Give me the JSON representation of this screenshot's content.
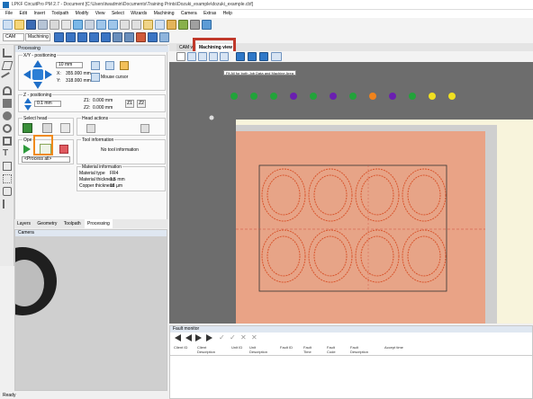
{
  "window": {
    "title": "LPKF CircuitPro PM 2.7 - Document [C:\\Users\\twadmin\\Documents\\Training Prints\\Dozuki_example\\dozuki_example.cbf]"
  },
  "menu": [
    "File",
    "Edit",
    "Insert",
    "Toolpath",
    "Modify",
    "View",
    "Select",
    "Wizards",
    "Machining",
    "Camera",
    "Extras",
    "Help"
  ],
  "toolbar2": {
    "cam_combo": "CAM",
    "machining_combo": "Machining"
  },
  "processing": {
    "header": "Processing",
    "xy_title": "X/Y - positioning",
    "step_value": "10 mm",
    "x_label": "X:",
    "x_value": "355.000 mm",
    "y_label": "Y:",
    "y_value": "318.000 mm",
    "mouse_cursor": "Mouse cursor",
    "z_title": "Z - positioning",
    "z_step": "0.1 mm",
    "z1_label": "Z1:",
    "z1_value": "0.000 mm",
    "z2_label": "Z2:",
    "z2_value": "0.000 mm",
    "z1_btn": "Z1",
    "z2_btn": "Z2",
    "select_head": "Select head",
    "head_actions": "Head actions",
    "operation": "Ope",
    "tool_info_title": "Tool information",
    "no_tool_info": "No tool information",
    "process_all": "<Process all>",
    "material_title": "Material information",
    "material_type_label": "Material type",
    "material_type": "FR4",
    "material_thickness_label": "Material thickness",
    "material_thickness": "1.5 mm",
    "copper_thickness_label": "Copper thickness",
    "copper_thickness": "18 µm"
  },
  "bottom_tabs": [
    "Layers",
    "Geometry",
    "Toolpath",
    "Processing"
  ],
  "camera": {
    "header": "Camera"
  },
  "main": {
    "tab_cam": "CAM vi",
    "tab_machining": "Machining view",
    "tooltip": "Fit All for both Job Data and Machine Area",
    "dots": [
      "#22a33a",
      "#22a33a",
      "#22a33a",
      "#6a1fb0",
      "#22a33a",
      "#6a1fb0",
      "#22a33a",
      "#f0831c",
      "#6a1fb0",
      "#22a33a",
      "#f0e020",
      "#f0e020"
    ]
  },
  "fault": {
    "header": "Fault monitor",
    "columns": [
      "Client ID",
      "Client Description",
      "Unit ID",
      "Unit Description",
      "Fault ID",
      "Fault Time",
      "Fault Code",
      "Fault Description",
      "Accept time"
    ]
  },
  "status": {
    "text": "Ready"
  },
  "colors": {
    "highlight": "#c0392b",
    "orange_box": "#f08a1c",
    "board": "#e9a386",
    "arrow_blue": "#1f6fc8"
  }
}
